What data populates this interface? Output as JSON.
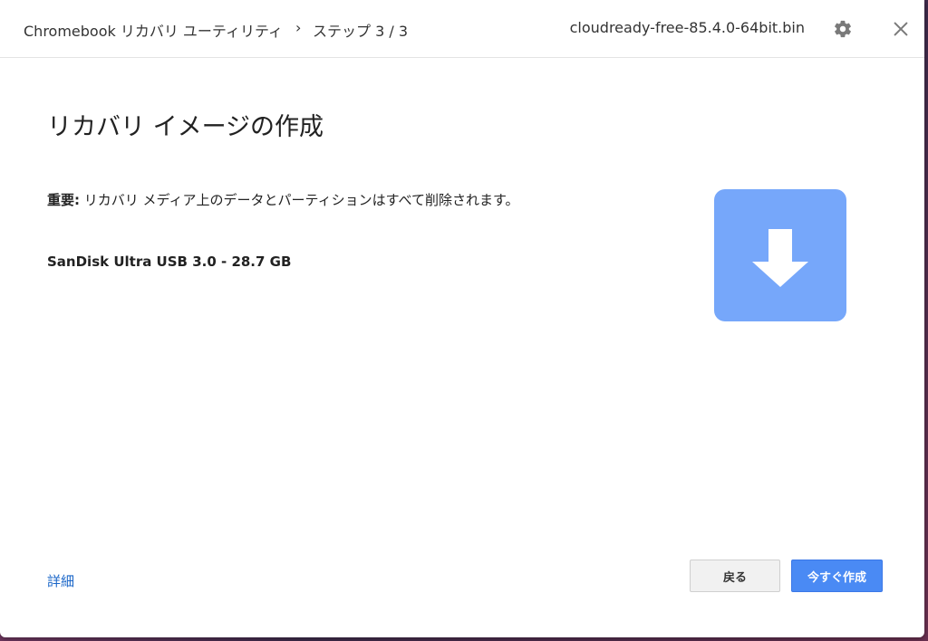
{
  "header": {
    "app_title": "Chromebook リカバリ ユーティリティ",
    "chevron": "›",
    "step": "ステップ 3 / 3",
    "file_name": "cloudready-free-85.4.0-64bit.bin",
    "settings_icon": "gear-icon",
    "close_icon": "close-icon"
  },
  "main": {
    "title": "リカバリ イメージの作成",
    "warning_label": "重要:",
    "warning_text": " リカバリ メディア上のデータとパーティションはすべて削除されます。",
    "device": "SanDisk Ultra USB 3.0 - 28.7 GB",
    "illustration_icon": "download-arrow-icon",
    "illustration_color": "#76a7fa"
  },
  "footer": {
    "details_link": "詳細",
    "back_button": "戻る",
    "create_button": "今すぐ作成"
  },
  "colors": {
    "accent": "#4a8af4",
    "link": "#1a66c8"
  }
}
